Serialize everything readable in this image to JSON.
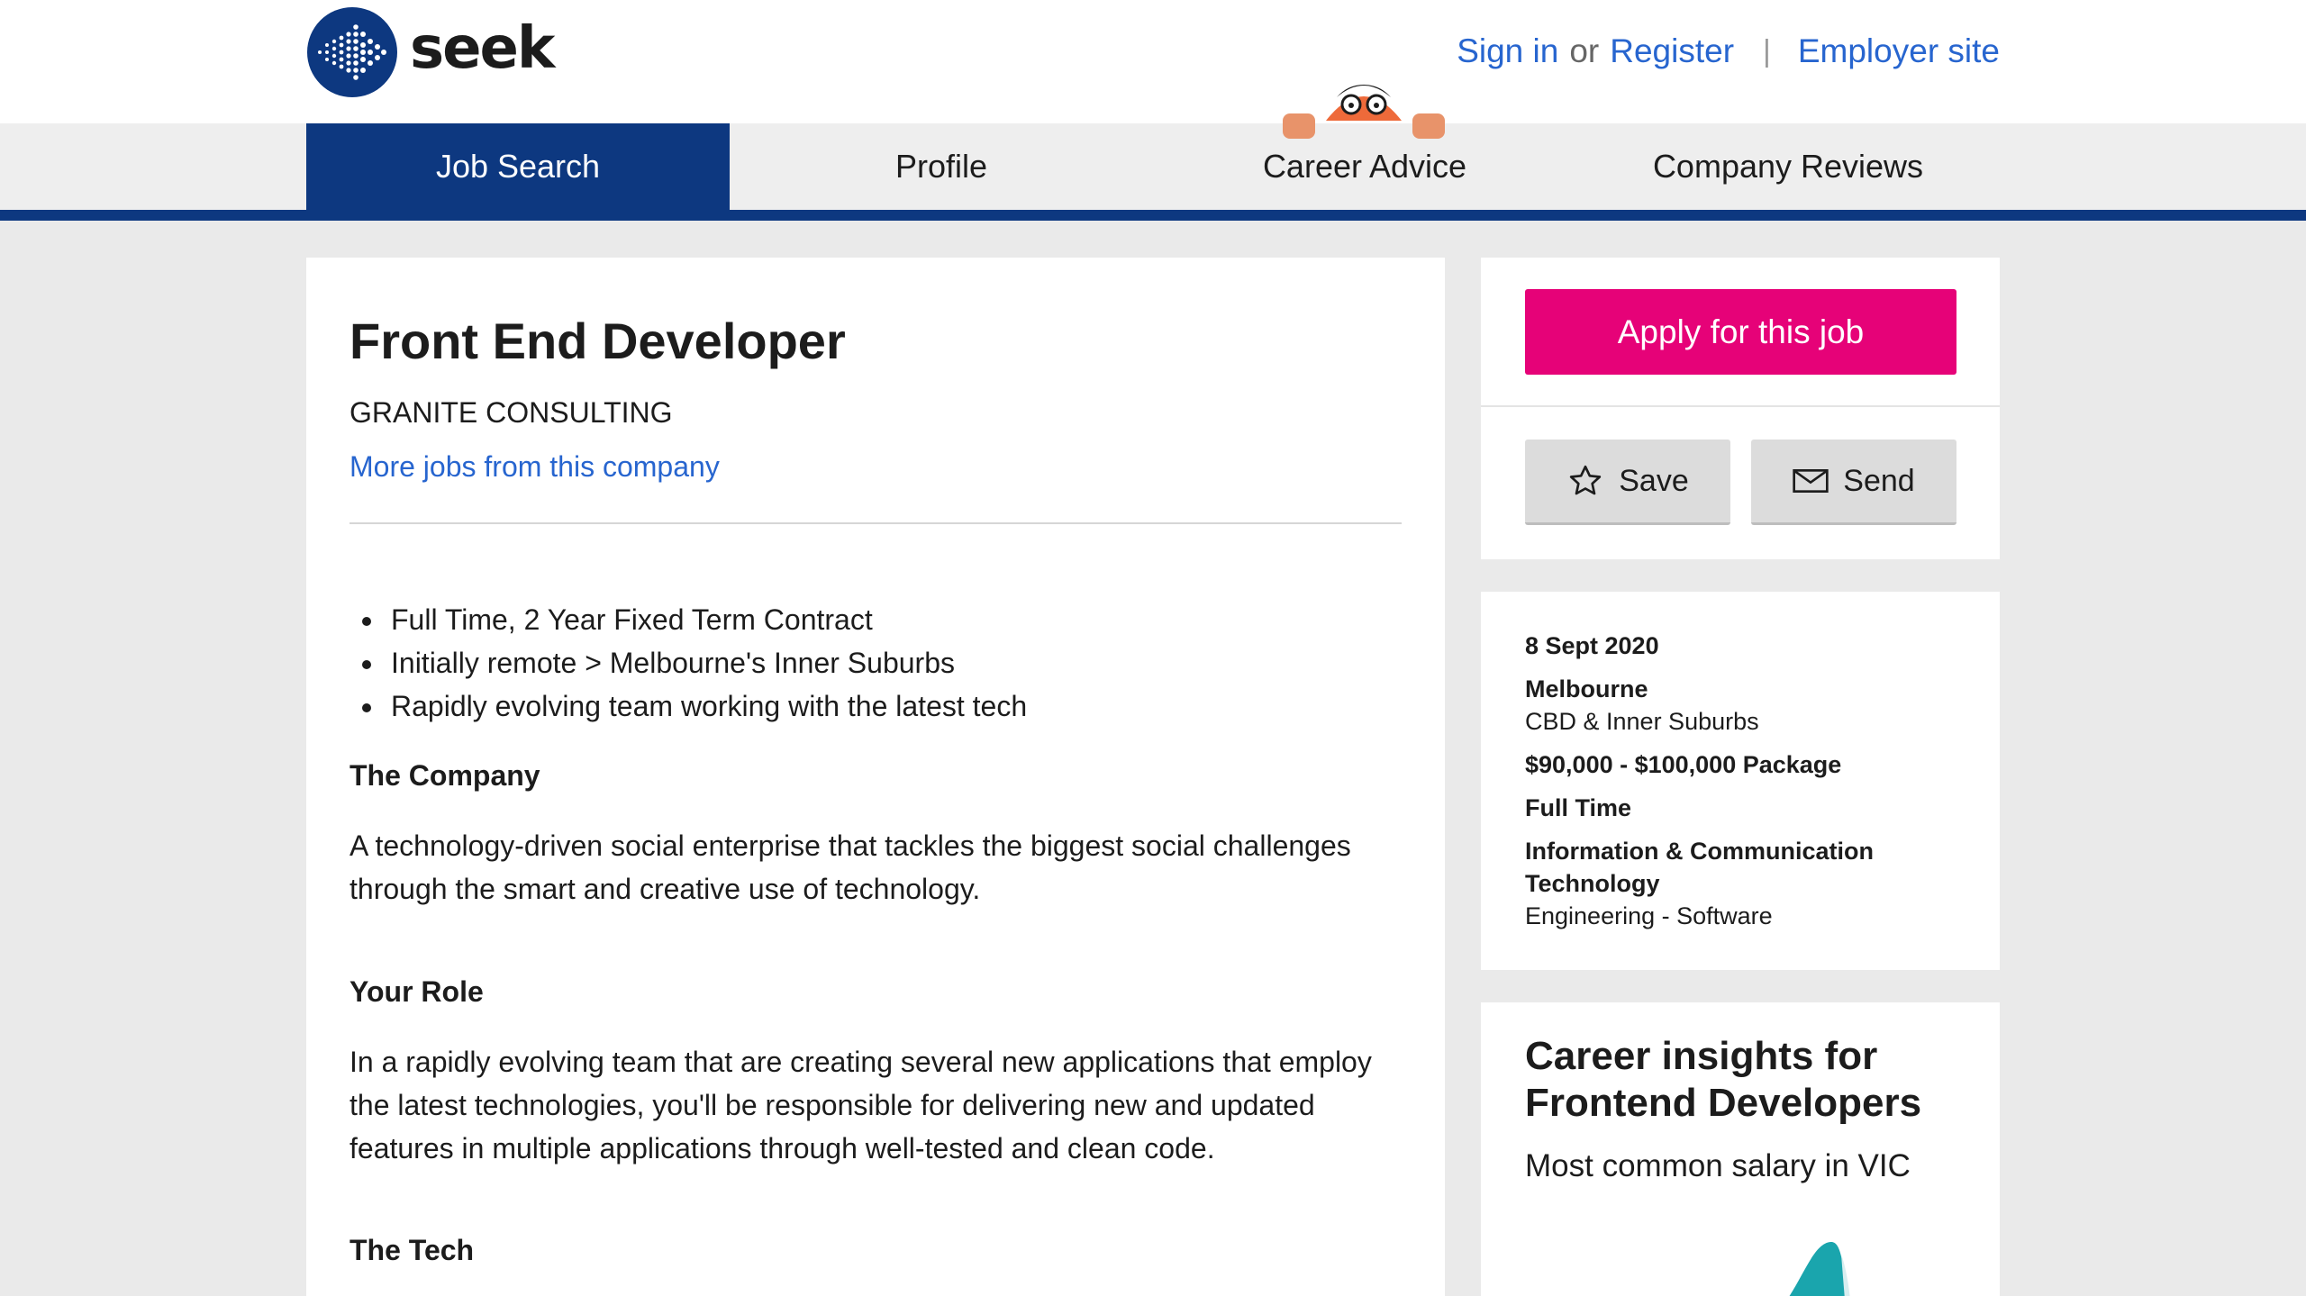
{
  "header": {
    "logo_text": "seek",
    "sign_in": "Sign in",
    "or": "or",
    "register": "Register",
    "separator": "|",
    "employer_site": "Employer site"
  },
  "nav": {
    "tabs": [
      {
        "label": "Job Search",
        "active": true
      },
      {
        "label": "Profile",
        "active": false
      },
      {
        "label": "Career Advice",
        "active": false
      },
      {
        "label": "Company Reviews",
        "active": false
      }
    ]
  },
  "job": {
    "title": "Front End Developer",
    "company": "GRANITE CONSULTING",
    "more_jobs_link": "More jobs from this company",
    "bullets": [
      "Full Time, 2 Year Fixed Term Contract",
      "Initially remote > Melbourne's Inner Suburbs",
      "Rapidly evolving team working with the latest tech"
    ],
    "sections": [
      {
        "heading": "The Company",
        "text": "A technology-driven social enterprise that tackles the biggest social challenges through the smart and creative use of technology."
      },
      {
        "heading": "Your Role",
        "text": "In a rapidly evolving team that are creating several new applications that employ the latest technologies, you'll be responsible for delivering new and updated features in multiple applications through well-tested and clean code."
      },
      {
        "heading": "The Tech",
        "text": ""
      }
    ]
  },
  "actions": {
    "apply_label": "Apply for this job",
    "save_label": "Save",
    "send_label": "Send"
  },
  "details": {
    "date": "8 Sept 2020",
    "location": "Melbourne",
    "area": "CBD & Inner Suburbs",
    "salary": "$90,000 - $100,000 Package",
    "work_type": "Full Time",
    "classification": "Information & Communication Technology",
    "sub_classification": "Engineering - Software"
  },
  "insights": {
    "title": "Career insights for Frontend Developers",
    "subtitle": "Most common salary in VIC"
  },
  "colors": {
    "brand_navy": "#0d3880",
    "link_blue": "#2765cf",
    "apply_pink": "#e60278",
    "chart_teal": "#1aa5ad"
  }
}
